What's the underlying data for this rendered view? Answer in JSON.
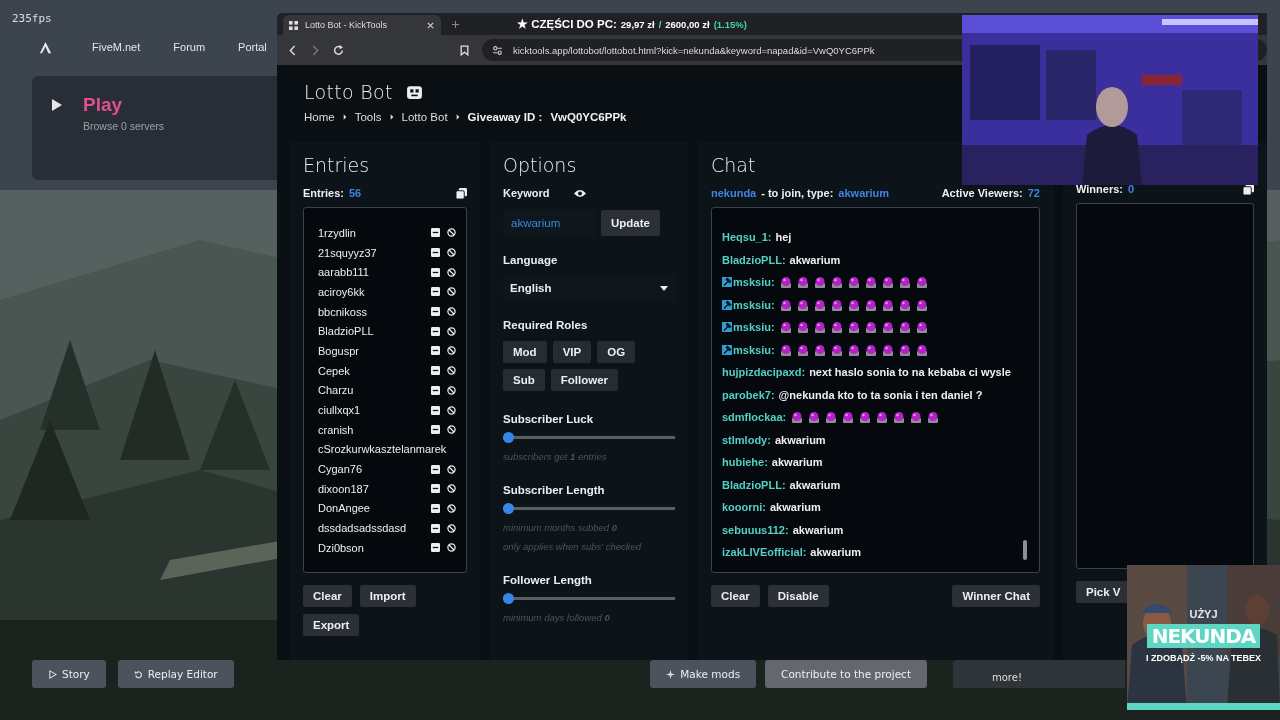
{
  "game_ui": {
    "fps": "235fps",
    "nav": [
      "FiveM.net",
      "Forum",
      "Portal"
    ],
    "play": {
      "title": "Play",
      "subtitle": "Browse 0 servers"
    },
    "bottom_left": [
      "Story",
      "Replay Editor"
    ],
    "bottom_right": [
      "Make mods",
      "Contribute to the project"
    ],
    "more_card": {
      "text": "more!"
    }
  },
  "browser": {
    "tab": {
      "title": "Lotto Bot - KickTools"
    },
    "overlay": {
      "label": "★ CZĘŚCI DO PC:",
      "current": "29,97 zł",
      "separator": "/",
      "goal": "2600,00 zł",
      "percent": "(1.15%)"
    },
    "url": "kicktools.app/lottobot/lottobot.html?kick=nekunda&keyword=napad&id=VwQ0YC6PPk"
  },
  "page": {
    "title": "Lotto Bot",
    "breadcrumbs": [
      "Home",
      "Tools",
      "Lotto Bot"
    ],
    "giveaway_label": "Giveaway ID :",
    "giveaway_id": "VwQ0YC6PPk"
  },
  "entries": {
    "heading": "Entries",
    "count_label": "Entries:",
    "count": "56",
    "items": [
      {
        "name": "1rzydlin",
        "actions": true
      },
      {
        "name": "21squyyz37",
        "actions": true
      },
      {
        "name": "aarabb111",
        "actions": true
      },
      {
        "name": "aciroy6kk",
        "actions": true
      },
      {
        "name": "bbcnikoss",
        "actions": true
      },
      {
        "name": "BladzioPLL",
        "actions": true
      },
      {
        "name": "Boguspr",
        "actions": true
      },
      {
        "name": "Cepek",
        "actions": true
      },
      {
        "name": "Charzu",
        "actions": true
      },
      {
        "name": "ciullxqx1",
        "actions": true
      },
      {
        "name": "cranish",
        "actions": true
      },
      {
        "name": "cSrozkurwkasztelanmarek",
        "actions": false
      },
      {
        "name": "Cygan76",
        "actions": true
      },
      {
        "name": "dixoon187",
        "actions": true
      },
      {
        "name": "DonAngee",
        "actions": true
      },
      {
        "name": "dssdadsadssdasd",
        "actions": true
      },
      {
        "name": "Dzi0bson",
        "actions": true
      }
    ],
    "buttons": [
      "Clear",
      "Import",
      "Export"
    ]
  },
  "options": {
    "heading": "Options",
    "keyword_label": "Keyword",
    "keyword_value": "akwarium",
    "update_button": "Update",
    "language_label": "Language",
    "language_value": "English",
    "roles_label": "Required Roles",
    "roles": [
      "Mod",
      "VIP",
      "OG",
      "Sub",
      "Follower"
    ],
    "sliders": [
      {
        "label": "Subscriber Luck",
        "level": 0,
        "hints": [
          "subscribers get **1** entries"
        ]
      },
      {
        "label": "Subscriber Length",
        "level": 0,
        "hints": [
          "minimum months subbed **0**",
          "only applies when subs' checked"
        ]
      },
      {
        "label": "Follower Length",
        "level": 0,
        "hints": [
          "minimum days followed **0**"
        ]
      }
    ]
  },
  "chat": {
    "heading": "Chat",
    "channel": "nekunda",
    "join_text": "- to join, type:",
    "keyword": "akwarium",
    "viewers_label": "Active Viewers:",
    "viewers": "72",
    "messages": [
      {
        "user": "Heqsu_1:",
        "mod": false,
        "kind": "text",
        "text": "hej"
      },
      {
        "user": "BladzioPLL:",
        "mod": false,
        "kind": "text",
        "text": "akwarium"
      },
      {
        "user": "msksiu:",
        "mod": true,
        "kind": "emotes",
        "emotes": [
          {
            "kind": "emote"
          },
          {
            "kind": "emote"
          },
          {
            "kind": "emote"
          },
          {
            "kind": "emote"
          },
          {
            "kind": "emote"
          },
          {
            "kind": "emote"
          },
          {
            "kind": "emote"
          },
          {
            "kind": "emote"
          },
          {
            "kind": "emote"
          }
        ]
      },
      {
        "user": "msksiu:",
        "mod": true,
        "kind": "emotes",
        "emotes": [
          {
            "kind": "emote"
          },
          {
            "kind": "emote"
          },
          {
            "kind": "emote"
          },
          {
            "kind": "emote"
          },
          {
            "kind": "emote"
          },
          {
            "kind": "emote"
          },
          {
            "kind": "emote"
          },
          {
            "kind": "emote"
          },
          {
            "kind": "emote"
          }
        ]
      },
      {
        "user": "msksiu:",
        "mod": true,
        "kind": "emotes",
        "emotes": [
          {
            "kind": "emote"
          },
          {
            "kind": "emote"
          },
          {
            "kind": "emote"
          },
          {
            "kind": "emote"
          },
          {
            "kind": "emote"
          },
          {
            "kind": "emote"
          },
          {
            "kind": "emote"
          },
          {
            "kind": "emote"
          },
          {
            "kind": "emote"
          }
        ]
      },
      {
        "user": "msksiu:",
        "mod": true,
        "kind": "emotes",
        "emotes": [
          {
            "kind": "emote"
          },
          {
            "kind": "emote"
          },
          {
            "kind": "emote"
          },
          {
            "kind": "emote"
          },
          {
            "kind": "emote"
          },
          {
            "kind": "emote"
          },
          {
            "kind": "emote"
          },
          {
            "kind": "emote"
          },
          {
            "kind": "emote"
          }
        ]
      },
      {
        "user": "hujpizdacipaxd:",
        "mod": false,
        "kind": "text",
        "text": "next haslo sonia to na kebaba ci wysle"
      },
      {
        "user": "parobek7:",
        "mod": false,
        "kind": "text",
        "text": "@nekunda kto to ta sonia i ten daniel ?"
      },
      {
        "user": "sdmflockaa:",
        "mod": false,
        "kind": "emotes",
        "emotes": [
          {
            "kind": "emote"
          },
          {
            "kind": "emote"
          },
          {
            "kind": "emote"
          },
          {
            "kind": "emote"
          },
          {
            "kind": "emote"
          },
          {
            "kind": "emote"
          },
          {
            "kind": "emote"
          },
          {
            "kind": "emote"
          },
          {
            "kind": "emote"
          }
        ]
      },
      {
        "user": "stlmlody:",
        "mod": false,
        "kind": "text",
        "text": "akwarium"
      },
      {
        "user": "hubiehe:",
        "mod": false,
        "kind": "text",
        "text": "akwarium"
      },
      {
        "user": "BladzioPLL:",
        "mod": false,
        "kind": "text",
        "text": "akwarium"
      },
      {
        "user": "kooorni:",
        "mod": false,
        "kind": "text",
        "text": "akwarium"
      },
      {
        "user": "sebuuus112:",
        "mod": false,
        "kind": "text",
        "text": "akwarium"
      },
      {
        "user": "izakLIVEofficial:",
        "mod": false,
        "kind": "text",
        "text": "akwarium"
      }
    ],
    "buttons": [
      "Clear",
      "Disable"
    ],
    "winner_chat_button": "Winner Chat"
  },
  "winners": {
    "count_label": "Winners:",
    "count": "0",
    "pick_button": "Pick V"
  },
  "ad": {
    "kind": "picture",
    "lead": "UŻYJ",
    "code": "NEKUNDA",
    "offer": "I ZDOBĄDŹ -5% NA TEBEX"
  }
}
